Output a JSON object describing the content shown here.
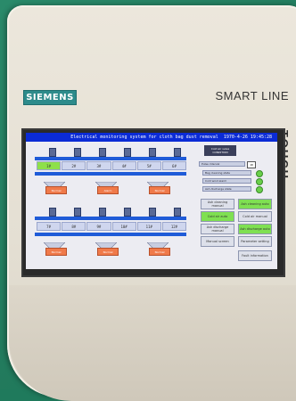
{
  "brand": {
    "logo": "SIEMENS",
    "product_line": "SMART LINE",
    "side_label": "TOUCH"
  },
  "screen": {
    "title": "Electrical monitoring system for cloth bag dust removal",
    "datetime": "1970-4-26 19:45:28",
    "cold_air_label": "Cold air valve CONDITION",
    "top_grid": [
      "1#",
      "2#",
      "3#",
      "4#",
      "5#",
      "6#"
    ],
    "bottom_grid": [
      "7#",
      "8#",
      "9#",
      "10#",
      "11#",
      "12#"
    ],
    "top_valves": [
      "1",
      "2",
      "3",
      "4",
      "5",
      "6"
    ],
    "bottom_valves": [
      "7",
      "8",
      "9",
      "10",
      "11",
      "12"
    ],
    "top_status_tags": [
      "Normal",
      "Alarm",
      "Normal"
    ],
    "bottom_status_tags": [
      "Normal",
      "Normal",
      "Normal"
    ],
    "pulse_interval": "Pulse interval",
    "pulse_value": "10",
    "status_rows": [
      "Bag cleaning state",
      "Cold wind alarm",
      "Ash discharge state"
    ],
    "buttons": [
      {
        "label": "Ash cleaning manual",
        "active": false
      },
      {
        "label": "Ash cleaning auto",
        "active": true
      },
      {
        "label": "Cold air auto",
        "active": true
      },
      {
        "label": "Cold air manual",
        "active": false
      },
      {
        "label": "Ash discharge manual",
        "active": false
      },
      {
        "label": "Ash discharge auto",
        "active": true
      },
      {
        "label": "Manual screen",
        "active": false
      },
      {
        "label": "Parameter setting",
        "active": false
      },
      {
        "label": "",
        "active": false
      },
      {
        "label": "Fault information",
        "active": false
      }
    ]
  }
}
